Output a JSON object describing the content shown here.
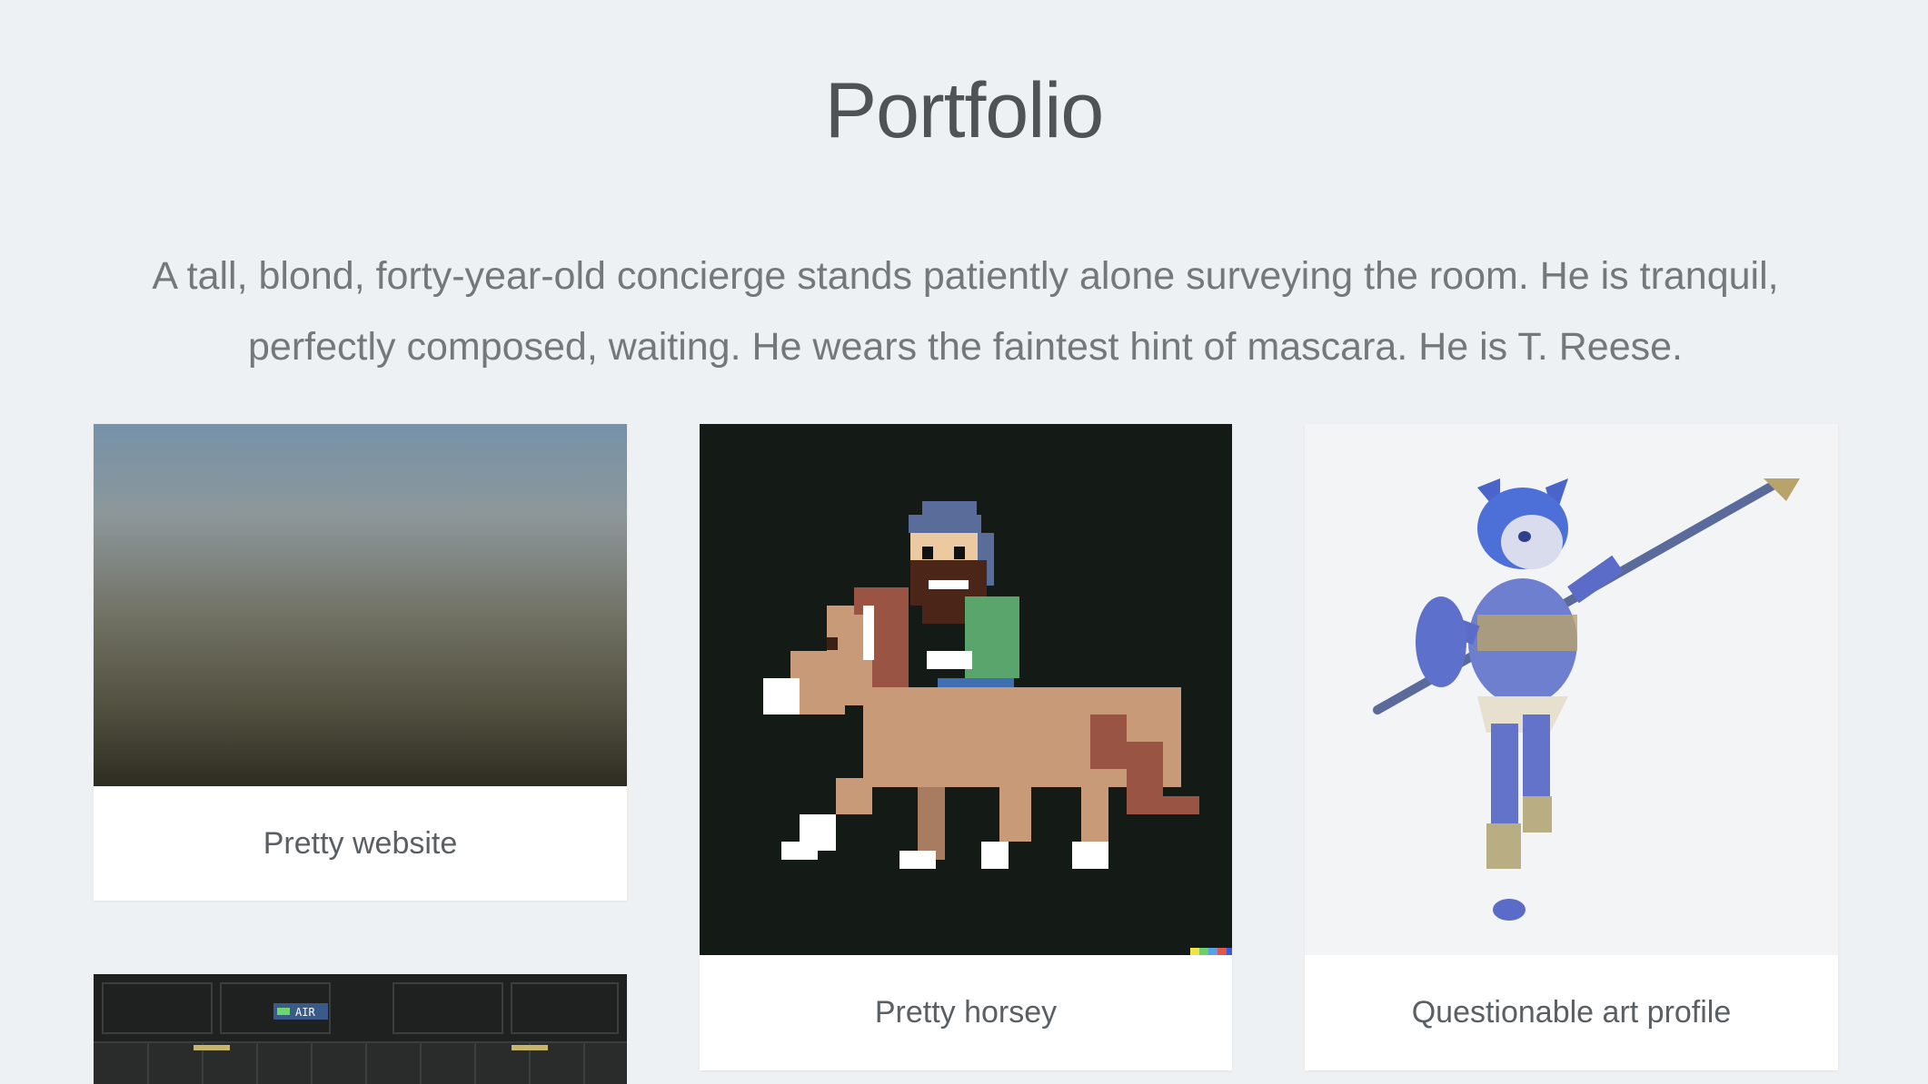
{
  "page": {
    "title": "Portfolio",
    "intro": "A tall, blond, forty-year-old concierge stands patiently alone surveying the room. He is tranquil, perfectly composed, waiting. He wears the faintest hint of mascara. He is T. Reese."
  },
  "cards": [
    {
      "caption": "Pretty website",
      "image": "blurred-gradient-photo"
    },
    {
      "caption": "Pretty horsey",
      "image": "pixel-art-man-riding-horse"
    },
    {
      "caption": "Questionable art profile",
      "image": "blue-fox-warrior-with-staff"
    },
    {
      "caption": "",
      "image": "pixel-game-screenshot",
      "screen_text": "AIR"
    }
  ],
  "colors": {
    "background": "#eef1f3",
    "card": "#ffffff",
    "title_text": "#4e5357",
    "body_text": "#73787c",
    "horse_bg": "#141a16"
  }
}
